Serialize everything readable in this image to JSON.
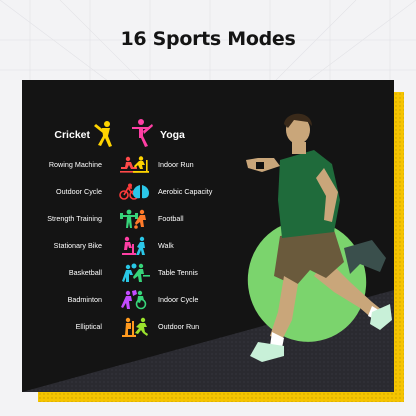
{
  "headline": "16 Sports Modes",
  "left_column": [
    {
      "label": "Cricket",
      "icon": "cricket-icon",
      "color": "#ffd400",
      "featured": true
    },
    {
      "label": "Rowing Machine",
      "icon": "rowing-machine-icon",
      "color": "#ff4a4a"
    },
    {
      "label": "Outdoor Cycle",
      "icon": "outdoor-cycle-icon",
      "color": "#ff3b3b"
    },
    {
      "label": "Strength Training",
      "icon": "strength-training-icon",
      "color": "#37d47a"
    },
    {
      "label": "Stationary Bike",
      "icon": "stationary-bike-icon",
      "color": "#ff3fa4"
    },
    {
      "label": "Basketball",
      "icon": "basketball-icon",
      "color": "#29c7e6"
    },
    {
      "label": "Badminton",
      "icon": "badminton-icon",
      "color": "#c34bff"
    },
    {
      "label": "Elliptical",
      "icon": "elliptical-icon",
      "color": "#ff9a1f"
    }
  ],
  "right_column": [
    {
      "label": "Yoga",
      "icon": "yoga-icon",
      "color": "#ff3fa4",
      "featured": true
    },
    {
      "label": "Indoor Run",
      "icon": "indoor-run-icon",
      "color": "#ffd400"
    },
    {
      "label": "Aerobic Capacity",
      "icon": "aerobic-capacity-icon",
      "color": "#2bc7e8"
    },
    {
      "label": "Football",
      "icon": "football-icon",
      "color": "#ff7a2a"
    },
    {
      "label": "Walk",
      "icon": "walk-icon",
      "color": "#2bc7e8"
    },
    {
      "label": "Table Tennis",
      "icon": "table-tennis-icon",
      "color": "#37d47a"
    },
    {
      "label": "Indoor Cycle",
      "icon": "indoor-cycle-icon",
      "color": "#37d47a"
    },
    {
      "label": "Outdoor Run",
      "icon": "outdoor-run-icon",
      "color": "#9be22d"
    }
  ],
  "colors": {
    "panel": "#141414",
    "accent_yellow": "#f5c400",
    "accent_green": "#7bd46d",
    "page_background": "#f3f3f5"
  }
}
